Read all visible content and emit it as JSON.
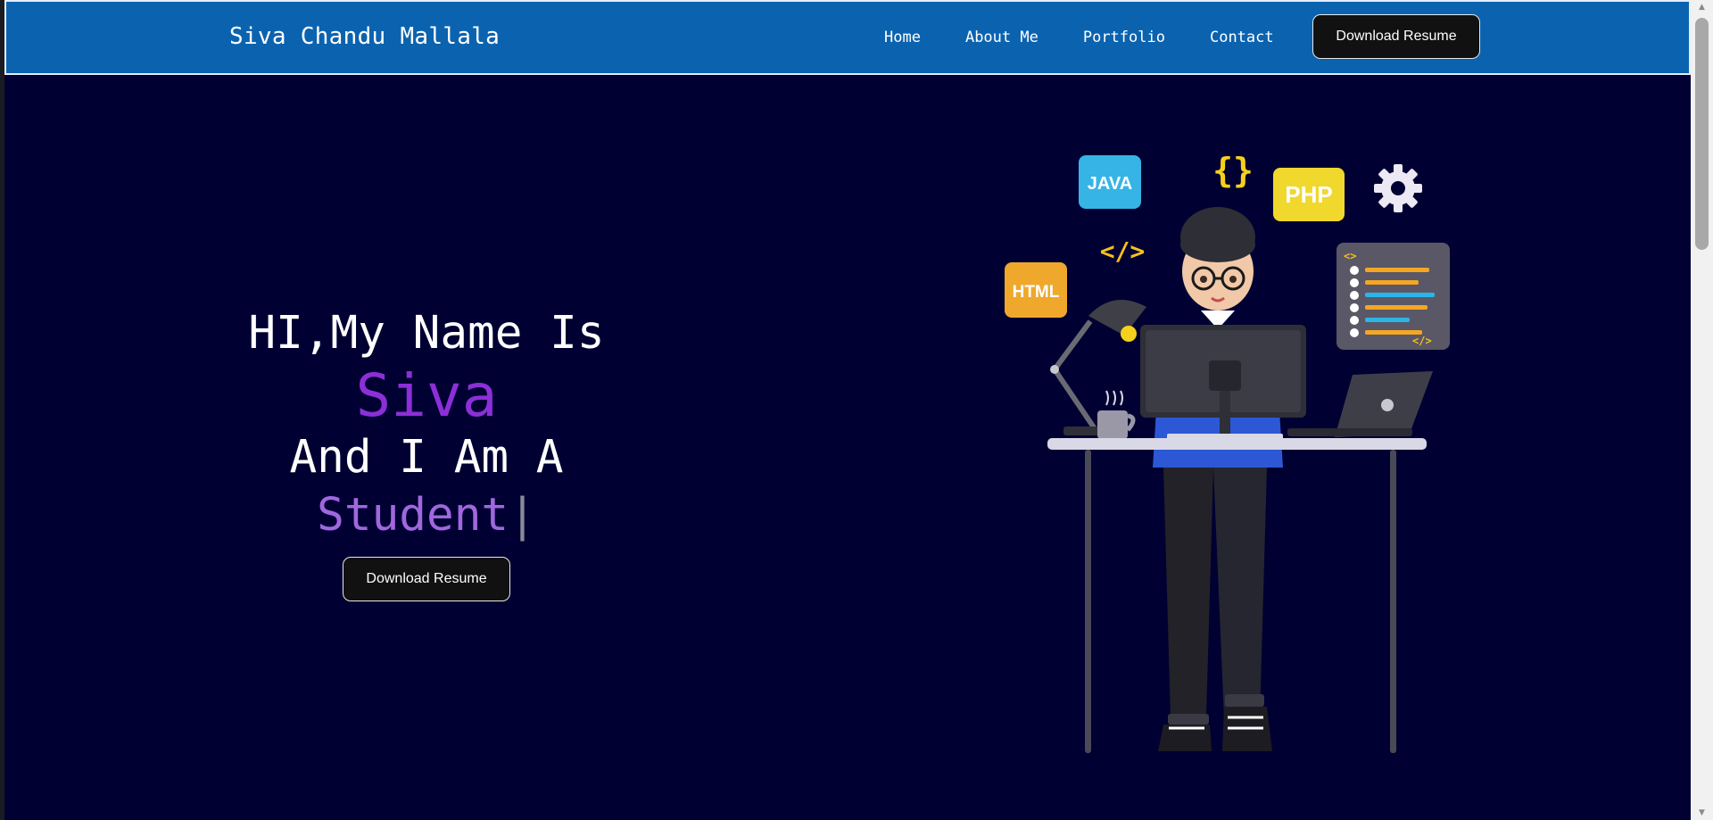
{
  "header": {
    "brand": "Siva Chandu Mallala",
    "nav": [
      "Home",
      "About Me",
      "Portfolio",
      "Contact"
    ],
    "download_label": "Download Resume"
  },
  "hero": {
    "greeting": "HI,My Name Is",
    "name": "Siva",
    "intro": "And I Am A",
    "role": "Student",
    "caret": "|",
    "download_label": "Download Resume"
  },
  "illustration": {
    "badges": {
      "java": "JAVA",
      "php": "PHP",
      "html": "HTML",
      "braces": "{}",
      "code_tag": "</>",
      "panel_top": "<>",
      "panel_bottom": "</>"
    },
    "icons": [
      "gear-icon",
      "coffee-mug-icon",
      "desk-lamp-icon",
      "laptop-icon",
      "monitor-icon"
    ]
  },
  "colors": {
    "header_bg": "#0b63b0",
    "page_bg": "#000033",
    "name_accent": "#8c2fd8",
    "role_accent": "#a067de",
    "button_bg": "#111111"
  }
}
